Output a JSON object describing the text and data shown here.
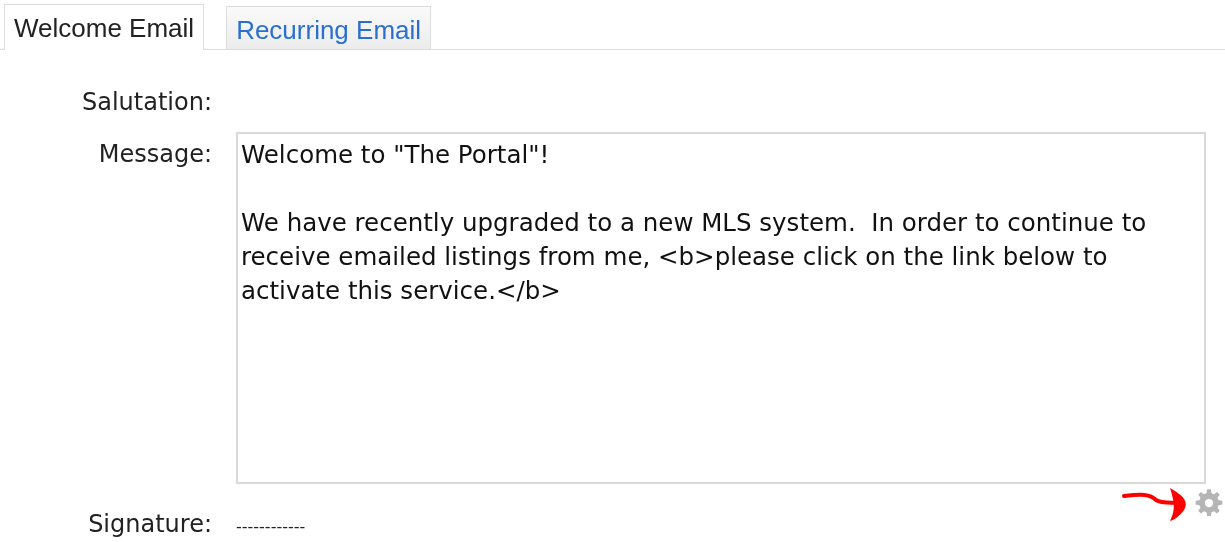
{
  "tabs": [
    {
      "label": "Welcome Email",
      "selected": true
    },
    {
      "label": "Recurring Email",
      "selected": false
    }
  ],
  "form": {
    "salutation": {
      "label": "Salutation:"
    },
    "message": {
      "label": "Message:",
      "value": "Welcome to \"The Portal\"!\n\nWe have recently upgraded to a new MLS system.  In order to continue to\nreceive emailed listings from me, <b>please click on the link below to\nactivate this service.</b>"
    },
    "signature": {
      "label": "Signature:",
      "value": "------------"
    }
  }
}
